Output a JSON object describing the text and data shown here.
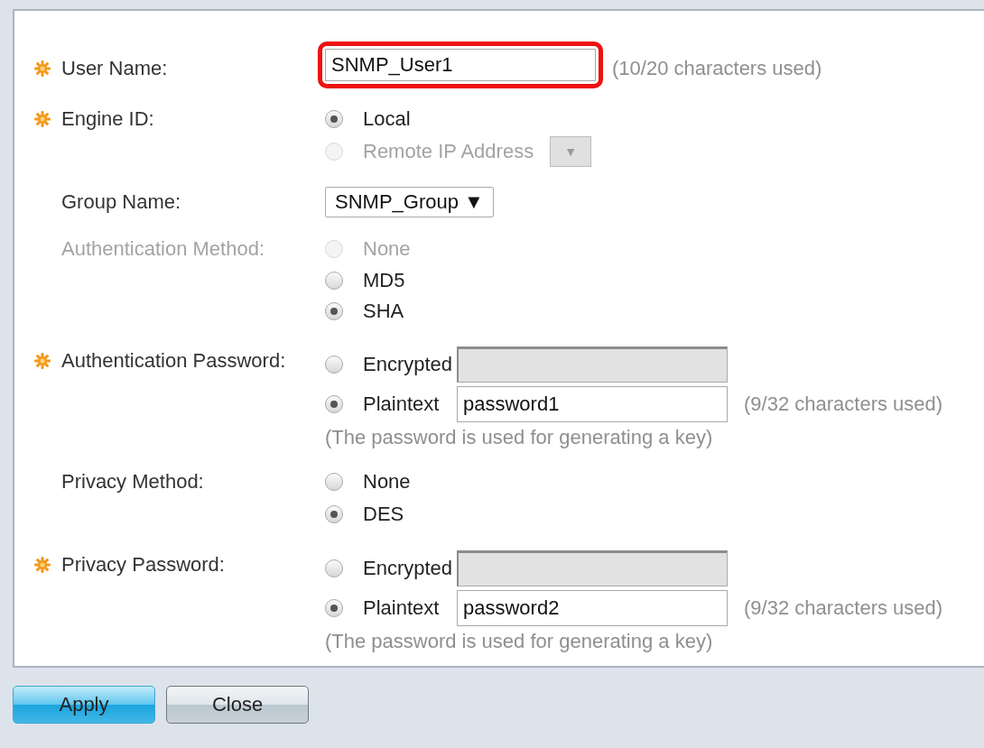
{
  "fields": [
    {
      "kind": "text",
      "required": true,
      "disabled": false,
      "label": "User Name:",
      "value": "SNMP_User1",
      "hint": "(10/20 characters used)",
      "highlighted": true
    },
    {
      "kind": "radio",
      "required": true,
      "disabled": false,
      "label": "Engine ID:",
      "options": [
        {
          "label": "Local",
          "selected": true,
          "disabled": false
        },
        {
          "label": "Remote IP Address",
          "selected": false,
          "disabled": true,
          "dropdown": {
            "arrow": "▼",
            "disabled": true
          }
        }
      ]
    },
    {
      "kind": "select",
      "required": false,
      "disabled": false,
      "label": "Group Name:",
      "value": "SNMP_Group",
      "arrow": "▼"
    },
    {
      "kind": "radio",
      "required": false,
      "disabled": true,
      "label": "Authentication Method:",
      "options": [
        {
          "label": "None",
          "selected": false,
          "disabled": true
        },
        {
          "label": "MD5",
          "selected": false,
          "disabled": false
        },
        {
          "label": "SHA",
          "selected": true,
          "disabled": false
        }
      ]
    },
    {
      "kind": "password",
      "required": true,
      "disabled": false,
      "label": "Authentication Password:",
      "options": [
        {
          "label": "Encrypted",
          "selected": false,
          "disabled": false,
          "field": {
            "disabled": true
          }
        },
        {
          "label": "Plaintext",
          "selected": true,
          "disabled": false,
          "field": {
            "value": "password1",
            "disabled": false
          },
          "hint": "(9/32 characters used)"
        }
      ],
      "note": "(The password is used for generating a key)"
    },
    {
      "kind": "radio",
      "required": false,
      "disabled": false,
      "label": "Privacy Method:",
      "options": [
        {
          "label": "None",
          "selected": false,
          "disabled": false
        },
        {
          "label": "DES",
          "selected": true,
          "disabled": false
        }
      ]
    },
    {
      "kind": "password",
      "required": true,
      "disabled": false,
      "label": "Privacy Password:",
      "options": [
        {
          "label": "Encrypted",
          "selected": false,
          "disabled": false,
          "field": {
            "disabled": true
          }
        },
        {
          "label": "Plaintext",
          "selected": true,
          "disabled": false,
          "field": {
            "value": "password2",
            "disabled": false
          },
          "hint": "(9/32 characters used)"
        }
      ],
      "note": "(The password is used for generating a key)"
    }
  ],
  "buttons": [
    {
      "label": "Apply",
      "primary": true
    },
    {
      "label": "Close",
      "primary": false
    }
  ]
}
